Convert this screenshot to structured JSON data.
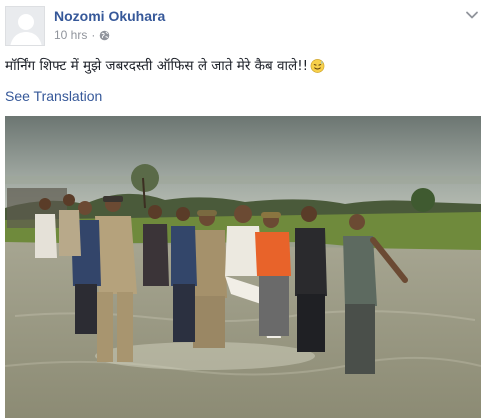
{
  "post": {
    "author": "Nozomi Okuhara",
    "timestamp": "10 hrs",
    "separator": "·",
    "text": "मॉर्निंग शिफ्ट में मुझे जबरदस्ती ऑफिस ले जाते मेरे कैब वाले!!",
    "see_translation": "See Translation",
    "privacy_icon": "globe-icon",
    "emoji_icon": "sweat-smile-emoji-icon"
  },
  "colors": {
    "link_blue": "#365899",
    "meta_gray": "#90949c",
    "text_dark": "#1d2129"
  }
}
